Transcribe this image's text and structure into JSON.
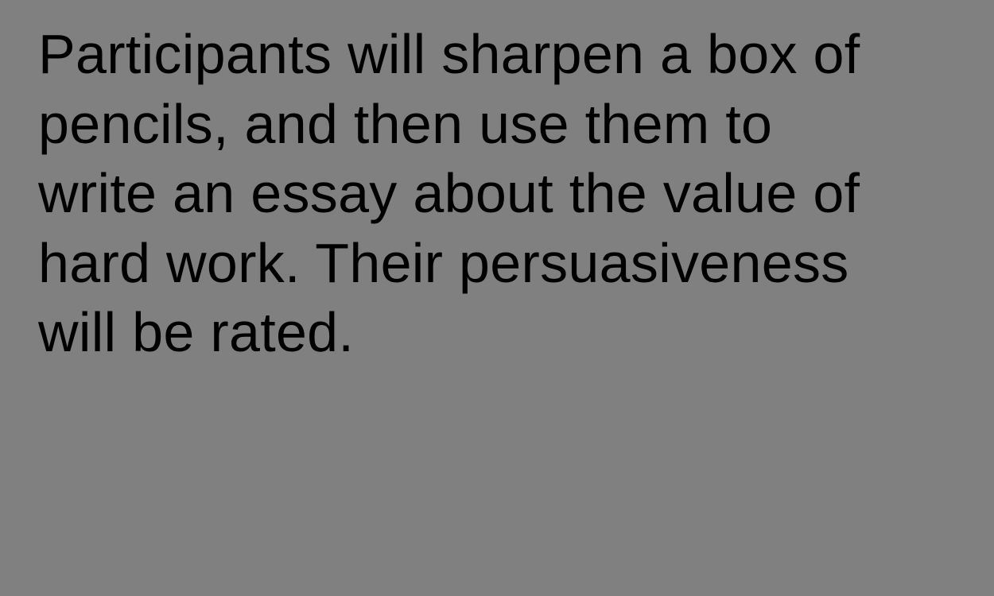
{
  "screen": {
    "background_color": "#808080",
    "text_color": "#000000"
  },
  "stimulus": {
    "lines": [
      "Participants will sharpen a box of",
      "pencils, and then use them to",
      "write an essay about the value of",
      "hard work. Their persuasiveness",
      "will be rated."
    ]
  }
}
